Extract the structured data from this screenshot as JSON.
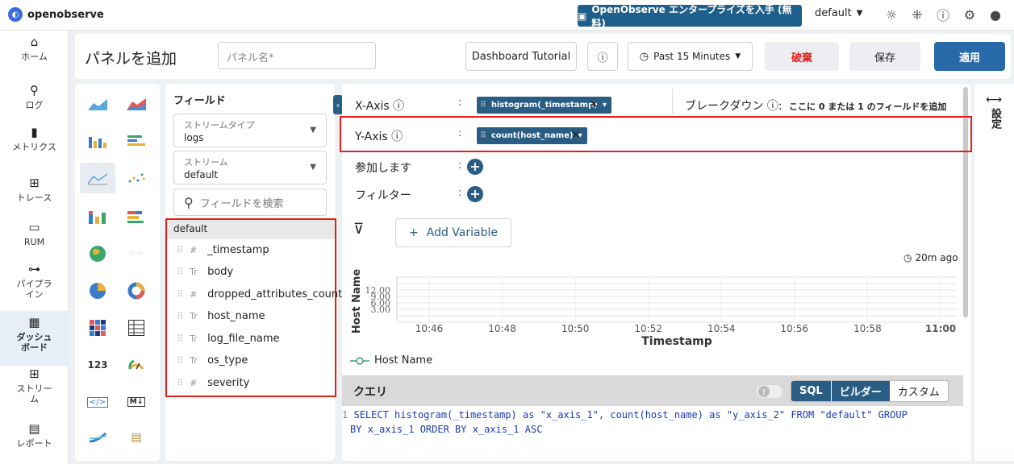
{
  "app": {
    "logo": "openobserve"
  },
  "topbar": {
    "enterprise_label": "OpenObserve エンタープライズを入手 (無料)",
    "org": "default"
  },
  "nav": {
    "items": [
      {
        "label": "ホーム",
        "icon": "home-icon"
      },
      {
        "label": "ログ",
        "icon": "search-icon"
      },
      {
        "label": "メトリクス",
        "icon": "bar-chart-icon"
      },
      {
        "label": "トレース",
        "icon": "trace-icon"
      },
      {
        "label": "RUM",
        "icon": "devices-icon"
      },
      {
        "label": "パイプライン",
        "icon": "pipeline-icon"
      },
      {
        "label": "ダッシュボード",
        "icon": "dashboard-icon"
      },
      {
        "label": "ストリーム",
        "icon": "grid-icon"
      },
      {
        "label": "レポート",
        "icon": "report-icon"
      }
    ]
  },
  "header": {
    "title": "パネルを追加",
    "name_placeholder": "パネル名*",
    "tutorial": "Dashboard Tutorial",
    "time_range": "Past 15 Minutes",
    "discard": "破棄",
    "save": "保存",
    "apply": "適用"
  },
  "fields": {
    "heading": "フィールド",
    "stream_type_label": "ストリームタイプ",
    "stream_type_value": "logs",
    "stream_label": "ストリーム",
    "stream_value": "default",
    "search_placeholder": "フィールドを検索",
    "group": "default",
    "list": [
      {
        "type": "#",
        "name": "_timestamp"
      },
      {
        "type": "Tr",
        "name": "body"
      },
      {
        "type": "#",
        "name": "dropped_attributes_count"
      },
      {
        "type": "Tr",
        "name": "host_name"
      },
      {
        "type": "Tr",
        "name": "log_file_name"
      },
      {
        "type": "Tr",
        "name": "os_type"
      },
      {
        "type": "#",
        "name": "severity"
      }
    ]
  },
  "builder": {
    "xaxis_label": "X-Axis ⓘ",
    "xaxis_chip": "histogram(_timestamp)",
    "breakdown_label": "ブレークダウン ⓘ:",
    "breakdown_hint": "ここに 0 または 1 のフィールドを追加",
    "yaxis_label": "Y-Axis ⓘ",
    "yaxis_chip": "count(host_name)",
    "join_label": "参加します",
    "filter_label": "フィルター",
    "add_variable": "Add Variable",
    "last_updated": "20m ago",
    "settings_label": "設定"
  },
  "chart_data": {
    "type": "line",
    "x": [
      "10:46",
      "10:48",
      "10:50",
      "10:52",
      "10:54",
      "10:56",
      "10:58",
      "11:00"
    ],
    "yticks": [
      "12.00",
      "9.00",
      "6.00",
      "3.00"
    ],
    "xlabel": "Timestamp",
    "ylabel": "Host Name",
    "series": [
      {
        "name": "Host Name",
        "values": []
      }
    ],
    "legend": "bottom-left"
  },
  "query": {
    "heading": "クエリ",
    "tabs": [
      "SQL",
      "ビルダー",
      "カスタム"
    ],
    "active_tab": "ビルダー",
    "line_no": "1",
    "sql_1": "SELECT histogram(_timestamp) as \"x_axis_1\", count(host_name) as \"y_axis_2\" FROM \"default\"  GROUP",
    "sql_2": "BY x_axis_1 ORDER BY x_axis_1 ASC"
  }
}
